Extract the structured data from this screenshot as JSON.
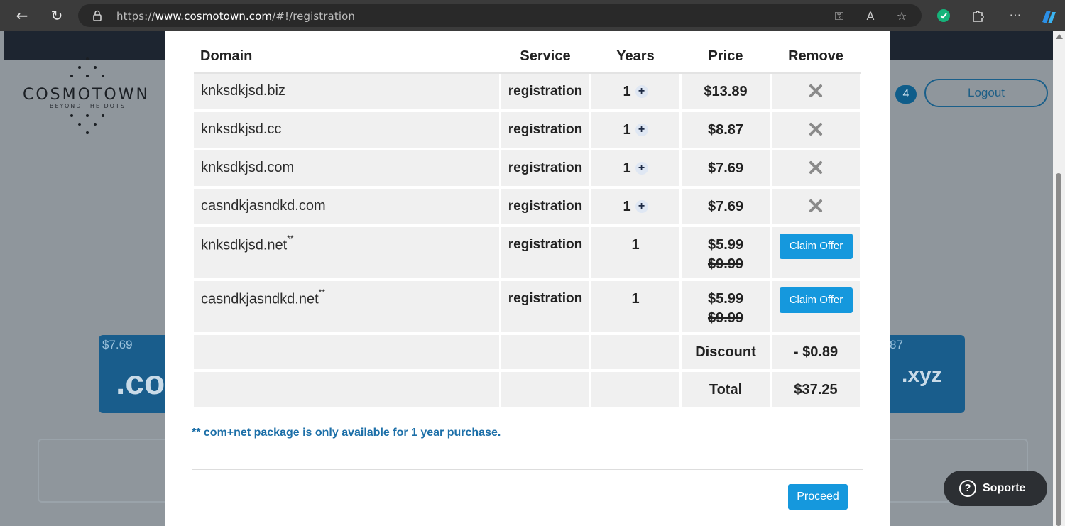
{
  "browser": {
    "url_prefix": "https://",
    "url_domain": "www.cosmotown.com",
    "url_path": "/#!/registration"
  },
  "background": {
    "logo_text": "COSMOTOWN",
    "logo_sub": "BEYOND THE DOTS",
    "cart_count": "4",
    "logout_label": "Logout",
    "tld_left_price": "$7.69",
    "tld_left_name": ".co",
    "tld_right_price": "87",
    "tld_right_name": ".xyz",
    "support_label": "Soporte"
  },
  "table": {
    "headers": {
      "domain": "Domain",
      "service": "Service",
      "years": "Years",
      "price": "Price",
      "remove": "Remove"
    },
    "rows": [
      {
        "domain": "knksdkjsd.biz",
        "service": "registration",
        "years": "1",
        "price": "$13.89"
      },
      {
        "domain": "knksdkjsd.cc",
        "service": "registration",
        "years": "1",
        "price": "$8.87"
      },
      {
        "domain": "knksdkjsd.com",
        "service": "registration",
        "years": "1",
        "price": "$7.69"
      },
      {
        "domain": "casndkjasndkd.com",
        "service": "registration",
        "years": "1",
        "price": "$7.69"
      }
    ],
    "offer_rows": [
      {
        "domain": "knksdkjsd.net",
        "mark": "**",
        "service": "registration",
        "years": "1",
        "price": "$5.99",
        "old_price": "$9.99",
        "button": "Claim Offer"
      },
      {
        "domain": "casndkjasndkd.net",
        "mark": "**",
        "service": "registration",
        "years": "1",
        "price": "$5.99",
        "old_price": "$9.99",
        "button": "Claim Offer"
      }
    ],
    "discount_label": "Discount",
    "discount_value": "- $0.89",
    "total_label": "Total",
    "total_value": "$37.25"
  },
  "note": "** com+net package is only available for 1 year purchase.",
  "proceed_label": "Proceed",
  "colors": {
    "accent": "#1598dd",
    "note": "#1c6fa8",
    "cell_bg": "#f0f0f0"
  }
}
